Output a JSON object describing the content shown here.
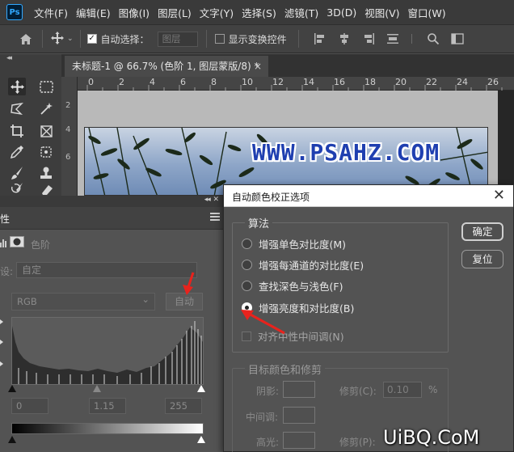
{
  "app": {
    "logo_text": "Ps",
    "accent": "#31a8ff"
  },
  "menu": [
    "文件(F)",
    "编辑(E)",
    "图像(I)",
    "图层(L)",
    "文字(Y)",
    "选择(S)",
    "滤镜(T)",
    "3D(D)",
    "视图(V)",
    "窗口(W)"
  ],
  "options_bar": {
    "auto_select_label": "自动选择：",
    "auto_select_checked": true,
    "target_select": "图层",
    "show_transform_label": "显示变换控件",
    "show_transform_checked": false,
    "icons": [
      "home-icon",
      "move-icon",
      "align-left-icon",
      "align-center-icon",
      "align-right-icon",
      "distribute-icon",
      "search-icon",
      "panel-icon"
    ]
  },
  "tools": [
    "move-tool",
    "marquee-tool",
    "lasso-tool",
    "magic-wand-tool",
    "crop-tool",
    "frame-tool",
    "eyedropper-tool",
    "patch-tool",
    "brush-tool",
    "stamp-tool",
    "history-brush-tool",
    "eraser-tool"
  ],
  "document": {
    "tab_title": "未标题-1 @ 66.7% (色阶 1, 图层蒙版/8) *",
    "tab_close": "×",
    "ruler_marks": [
      "0",
      "2",
      "4",
      "6",
      "8",
      "10",
      "12",
      "14",
      "16",
      "18",
      "20",
      "22",
      "24",
      "26"
    ],
    "watermark_text": "WWW.PSAHZ.COM"
  },
  "properties": {
    "tab_label": "性",
    "adjustment_title": "色阶",
    "preset_label": "设:",
    "preset_value": "自定",
    "channel": "RGB",
    "auto_label": "自动",
    "input_black": "0",
    "input_gamma": "1.15",
    "input_white": "255"
  },
  "dialog": {
    "title": "自动颜色校正选项",
    "close": "✕",
    "algorithm_group": "算法",
    "options": [
      {
        "label": "增强单色对比度(M)",
        "selected": false
      },
      {
        "label": "增强每通道的对比度(E)",
        "selected": false
      },
      {
        "label": "查找深色与浅色(F)",
        "selected": false
      },
      {
        "label": "增强亮度和对比度(B)",
        "selected": true
      }
    ],
    "snap_neutral_label": "对齐中性中间调(N)",
    "snap_neutral_checked": false,
    "ok_label": "确定",
    "reset_label": "复位",
    "target_group": "目标颜色和修剪",
    "shadows_label": "阴影:",
    "midtones_label": "中间调:",
    "highlights_label": "高光:",
    "clip_label": "修剪(C):",
    "clip_value": "0.10",
    "clip_unit": "%",
    "clip_label_2": "修剪(P):"
  },
  "site_watermark": "UiBQ.CoM",
  "colors": {
    "annotation_red": "#e8231d",
    "dialog_bg": "#535353",
    "titlebar": "#ffffff"
  }
}
